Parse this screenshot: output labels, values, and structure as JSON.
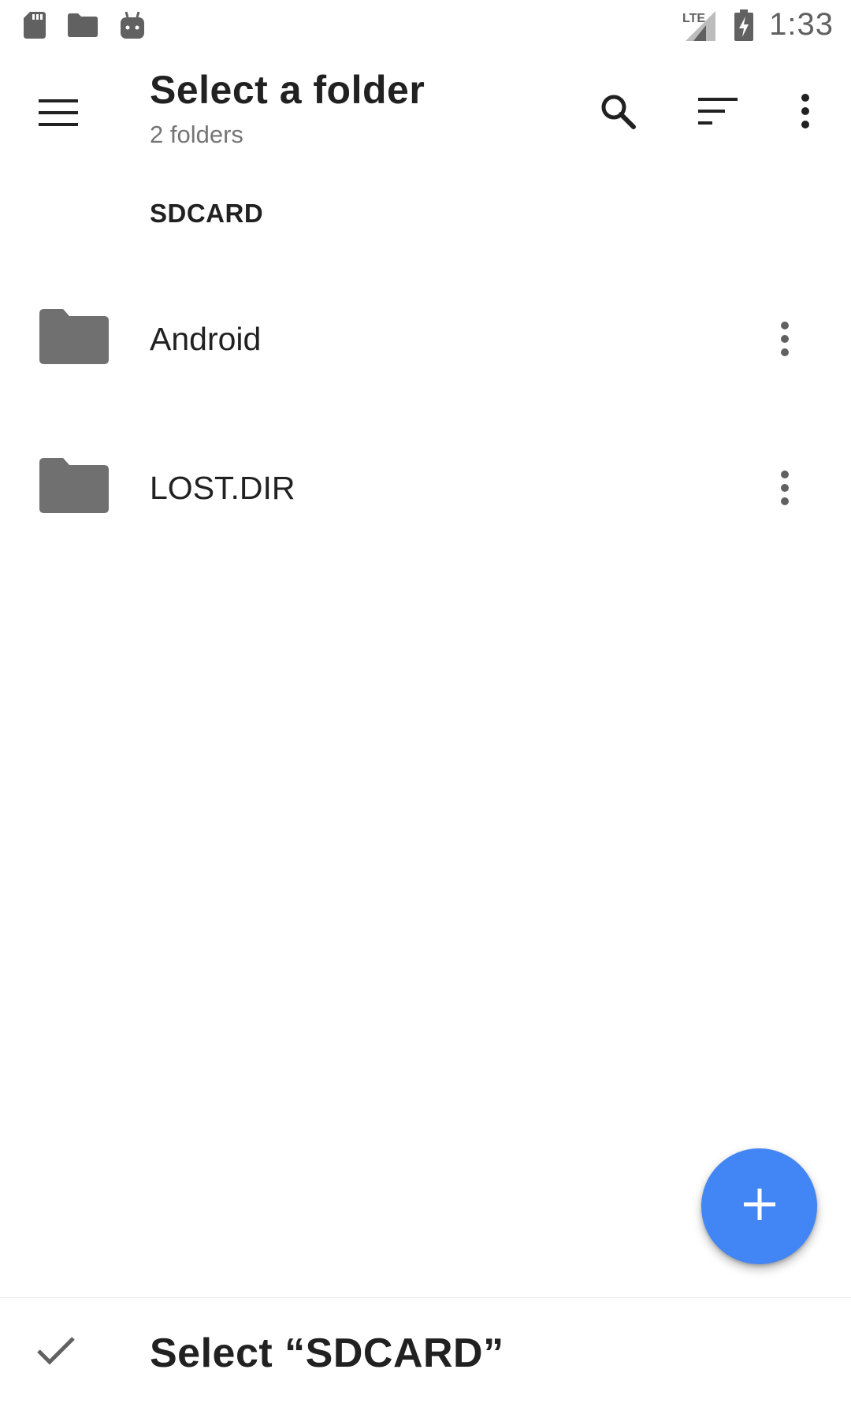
{
  "status_bar": {
    "time": "1:33",
    "network": "LTE",
    "icons": [
      "sd-card-icon",
      "folder-icon",
      "android-icon",
      "signal-icon",
      "battery-charging-icon"
    ]
  },
  "toolbar": {
    "title": "Select a folder",
    "subtitle": "2 folders",
    "icons": [
      "menu-icon",
      "search-icon",
      "sort-icon",
      "more-vert-icon"
    ]
  },
  "section": {
    "header": "SDCARD"
  },
  "folders": [
    {
      "name": "Android",
      "icon": "folder-icon"
    },
    {
      "name": "LOST.DIR",
      "icon": "folder-icon"
    }
  ],
  "fab": {
    "icon": "plus-icon"
  },
  "bottom_bar": {
    "label": "Select “SDCARD”",
    "icon": "check-icon"
  },
  "colors": {
    "accent": "#4285f4",
    "icon_gray": "#616161",
    "text_primary": "#212121",
    "text_secondary": "#757575"
  }
}
